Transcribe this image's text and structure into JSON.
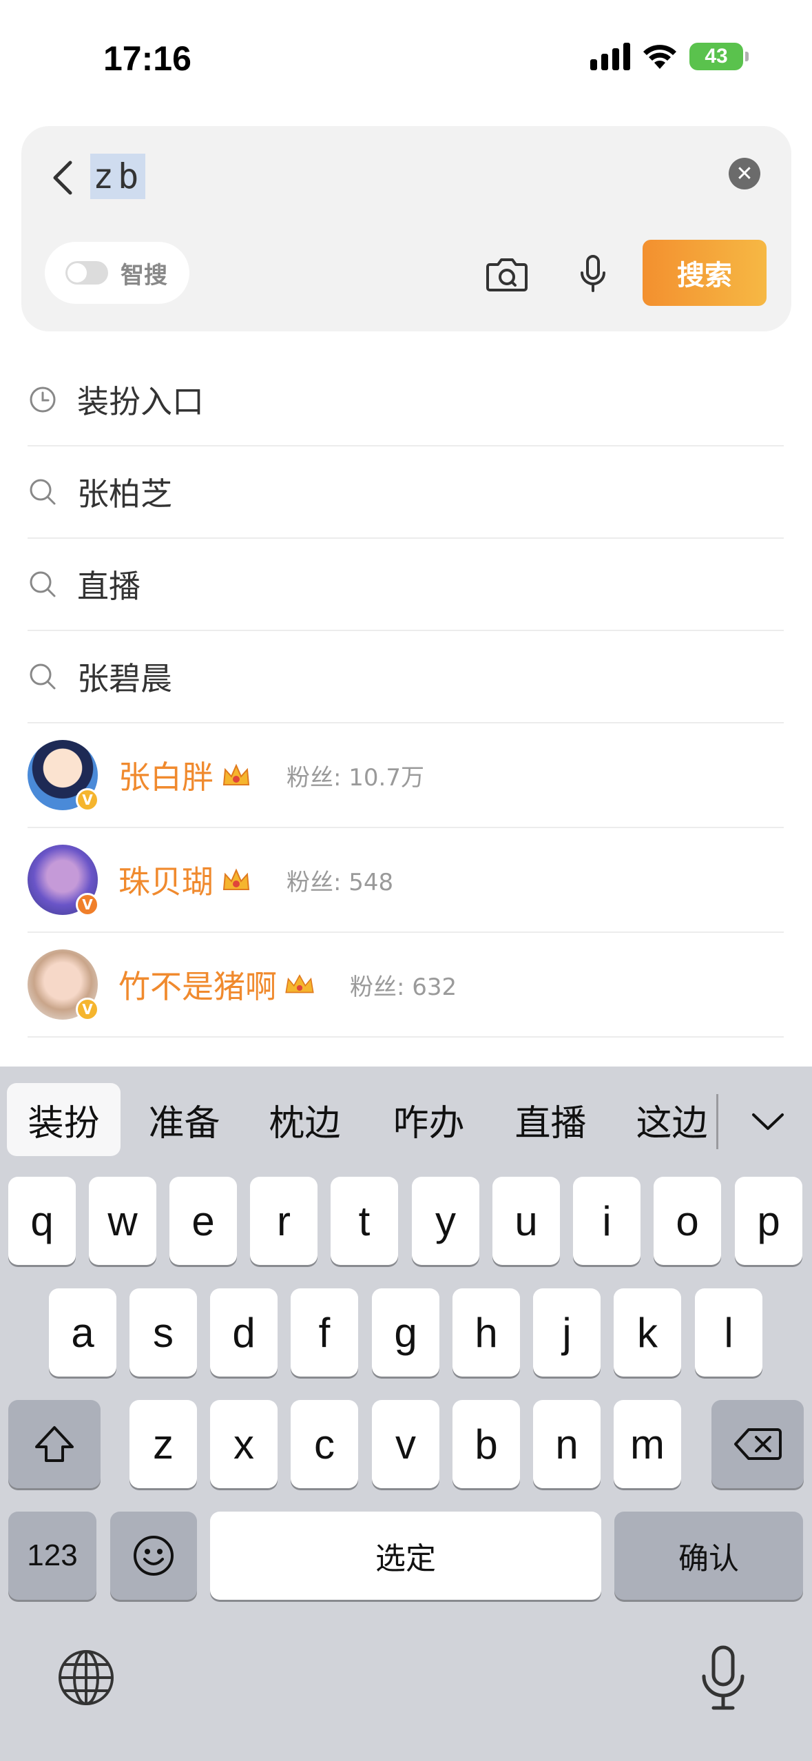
{
  "status_bar": {
    "time": "17:16",
    "battery": "43"
  },
  "search": {
    "query": "zb",
    "smart_search_label": "智搜",
    "search_button": "搜索"
  },
  "suggestions": [
    {
      "type": "history",
      "icon": "clock-icon",
      "text": "装扮入口"
    },
    {
      "type": "query",
      "icon": "search-icon",
      "text": "张柏芝"
    },
    {
      "type": "query",
      "icon": "search-icon",
      "text": "直播"
    },
    {
      "type": "query",
      "icon": "search-icon",
      "text": "张碧晨"
    }
  ],
  "users": [
    {
      "name": "张白胖",
      "fans": "粉丝: 10.7万",
      "badge": "V",
      "badge_color": "#f5b52e"
    },
    {
      "name": "珠贝瑚",
      "fans": "粉丝: 548",
      "badge": "V",
      "badge_color": "#f07f2a"
    },
    {
      "name": "竹不是猪啊",
      "fans": "粉丝: 632",
      "badge": "V",
      "badge_color": "#f5b52e"
    }
  ],
  "keyboard": {
    "candidates": [
      "装扮",
      "准备",
      "枕边",
      "咋办",
      "直播",
      "这边"
    ],
    "row1": [
      "q",
      "w",
      "e",
      "r",
      "t",
      "y",
      "u",
      "i",
      "o",
      "p"
    ],
    "row2": [
      "a",
      "s",
      "d",
      "f",
      "g",
      "h",
      "j",
      "k",
      "l"
    ],
    "row3": [
      "z",
      "x",
      "c",
      "v",
      "b",
      "n",
      "m"
    ],
    "numbers_key": "123",
    "space_key": "选定",
    "confirm_key": "确认"
  },
  "colors": {
    "accent_orange": "#f08a2e",
    "search_button_gradient": [
      "#f3902f",
      "#f6b844"
    ],
    "keyboard_bg": "#d1d3d9"
  }
}
